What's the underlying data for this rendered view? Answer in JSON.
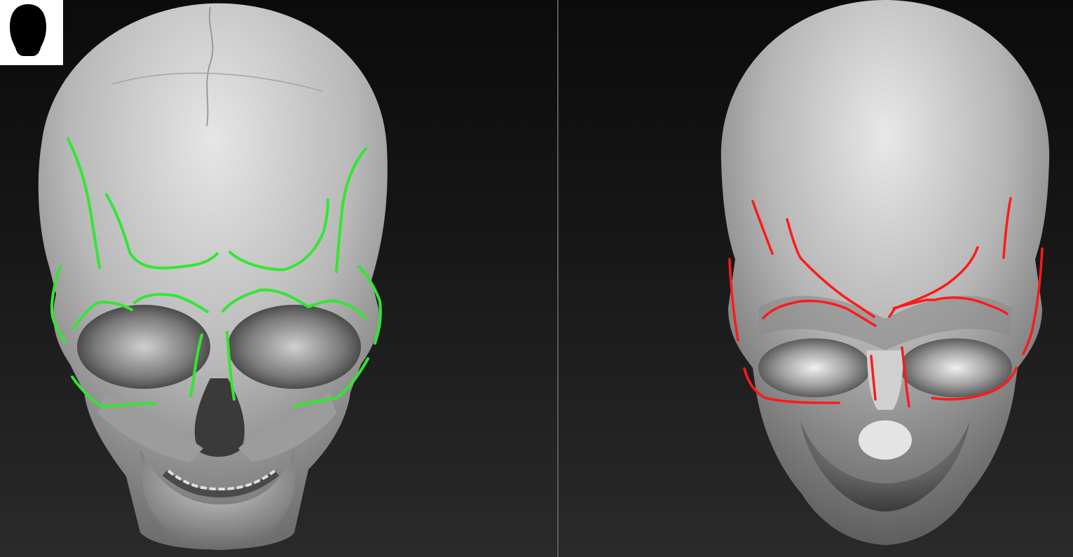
{
  "views": {
    "left": {
      "model": "skull-sculpt",
      "guide_color": "#33e633"
    },
    "right": {
      "model": "blockout-head-sculpt",
      "guide_color": "#ff1a1a"
    }
  },
  "navigator": {
    "icon": "head-silhouette-icon"
  }
}
